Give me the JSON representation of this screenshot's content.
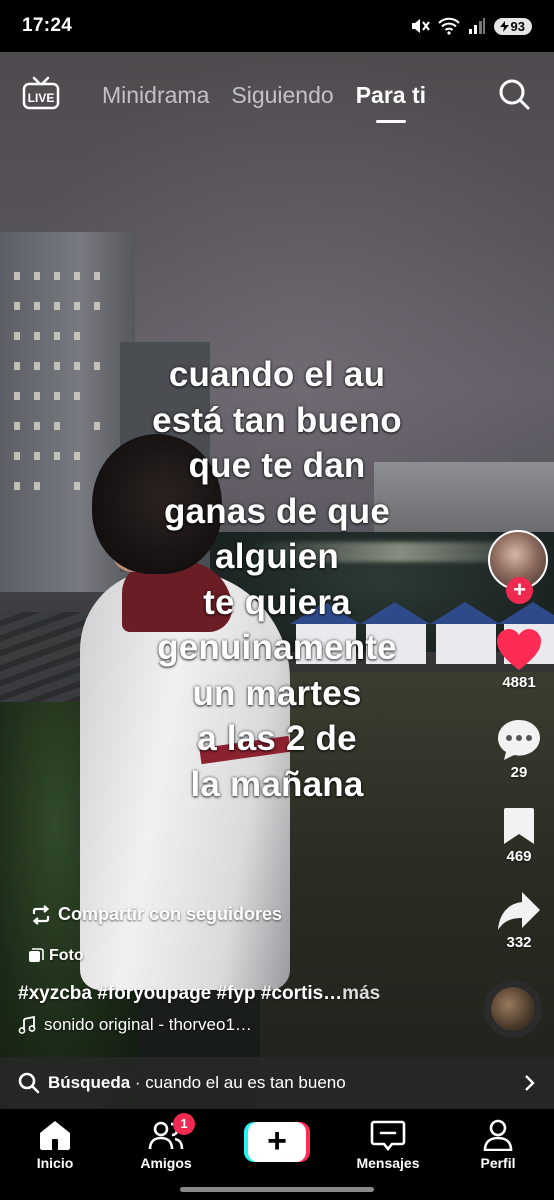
{
  "status_bar": {
    "time": "17:24",
    "battery": "93",
    "icons": [
      "mute-icon",
      "wifi-icon",
      "signal-icon",
      "battery-icon"
    ]
  },
  "top_nav": {
    "live_label": "LIVE",
    "tabs": [
      {
        "label": "Minidrama",
        "active": false
      },
      {
        "label": "Siguiendo",
        "active": false
      },
      {
        "label": "Para ti",
        "active": true
      }
    ]
  },
  "caption": {
    "lines": [
      "cuando el au",
      "está tan bueno",
      "que te dan",
      "ganas de que",
      "alguien",
      "te quiera",
      "genuinamente",
      "un martes",
      "a las 2 de",
      "la mañana"
    ]
  },
  "actions": {
    "likes": "4881",
    "comments": "29",
    "saves": "469",
    "shares": "332",
    "follow_symbol": "+"
  },
  "post_info": {
    "share_label": "Compartir con seguidores",
    "photo_label": "Foto",
    "hashtags": "#xyzcba #foryoupage #fyp #cortis…",
    "more_label": "más",
    "sound": "sonido original - thorveo1…"
  },
  "search_suggestion": {
    "prefix": "Búsqueda",
    "separator": " · ",
    "query": "cuando el au es tan bueno"
  },
  "bottom_nav": {
    "items": [
      {
        "label": "Inicio"
      },
      {
        "label": "Amigos",
        "badge": "1"
      },
      {
        "label": ""
      },
      {
        "label": "Mensajes"
      },
      {
        "label": "Perfil"
      }
    ],
    "create_symbol": "+"
  },
  "colors": {
    "accent_red": "#ef2950",
    "like_red": "#fe2c55",
    "cyan": "#25f4ee"
  }
}
